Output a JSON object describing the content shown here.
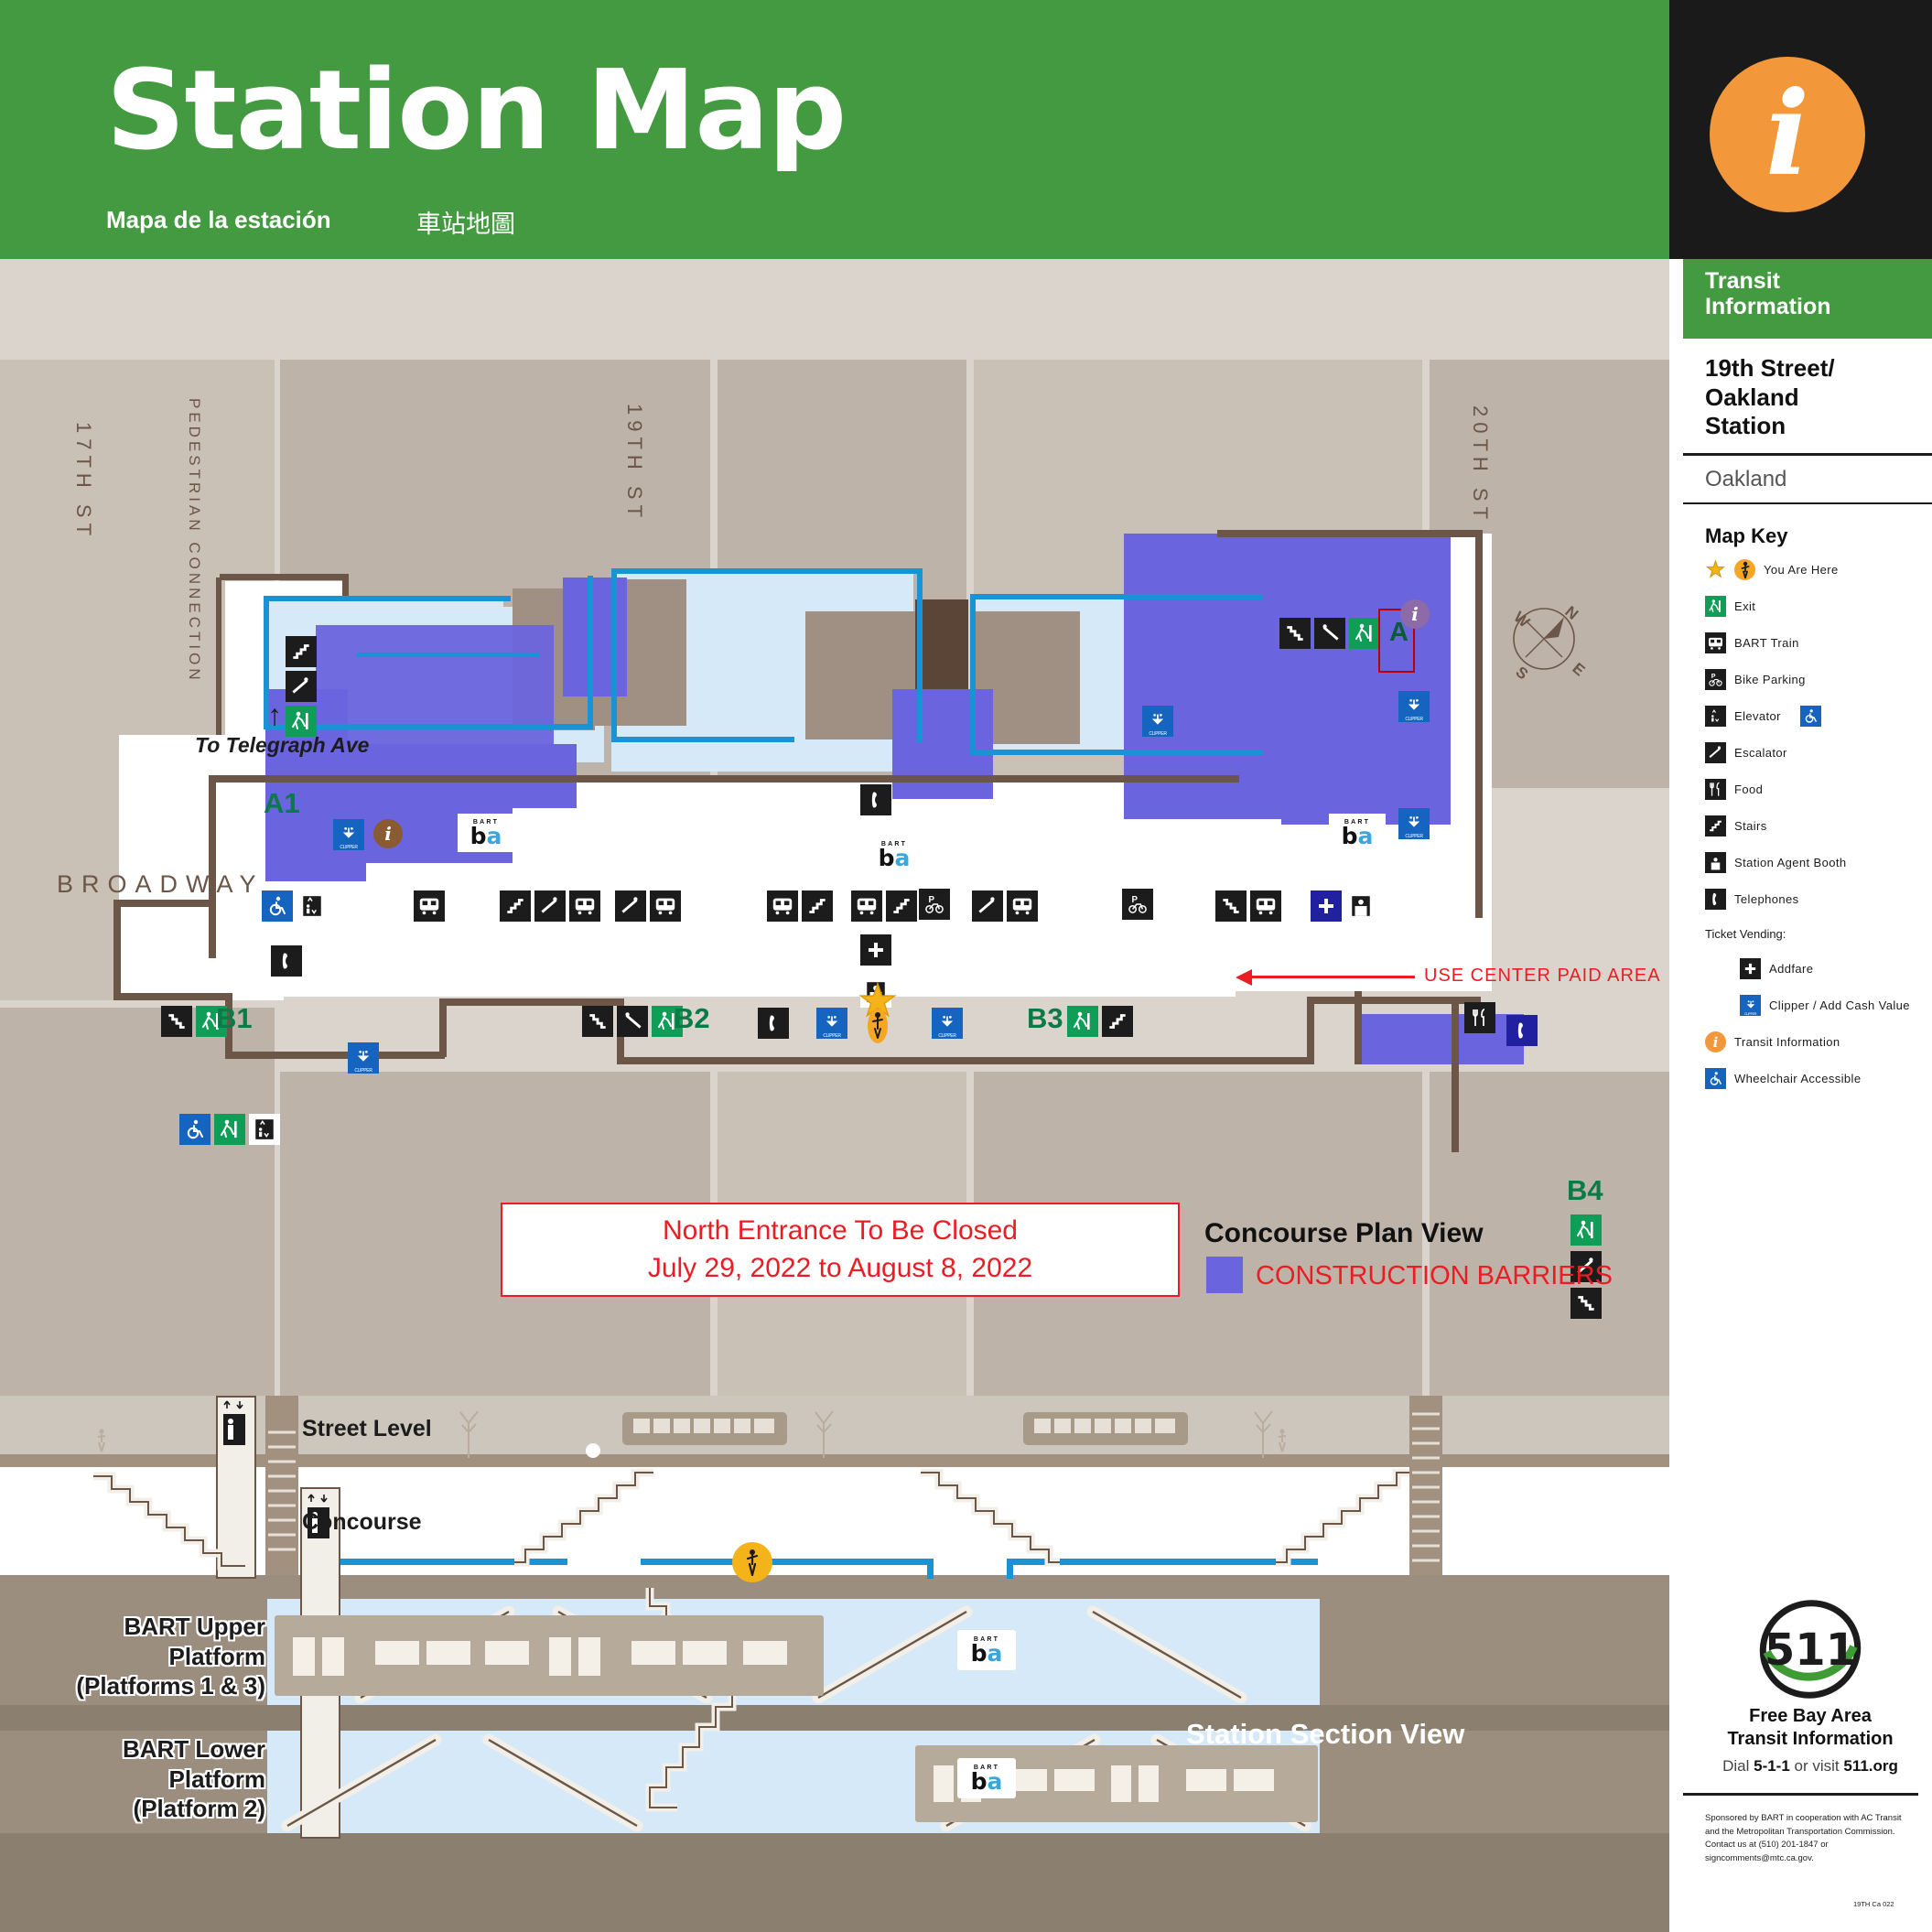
{
  "header": {
    "title": "Station Map",
    "subtitle_es": "Mapa de la estación",
    "subtitle_zh": "車站地圖",
    "info_glyph": "i",
    "green": "#449a40",
    "orange": "#f3973b"
  },
  "panel": {
    "band_title": "Transit\nInformation",
    "station_name": "19th Street/\nOakland\nStation",
    "city": "Oakland",
    "map_key_title": "Map Key",
    "key_items": [
      {
        "icon": "you-are-here-icon",
        "label": "You Are Here"
      },
      {
        "icon": "exit-icon",
        "label": "Exit"
      },
      {
        "icon": "bart-train-icon",
        "label": "BART Train"
      },
      {
        "icon": "bike-parking-icon",
        "label": "Bike Parking"
      },
      {
        "icon": "elevator-icon",
        "label": "Elevator",
        "extra_icon": "wheelchair-icon"
      },
      {
        "icon": "escalator-icon",
        "label": "Escalator"
      },
      {
        "icon": "food-icon",
        "label": "Food"
      },
      {
        "icon": "stairs-icon",
        "label": "Stairs"
      },
      {
        "icon": "station-agent-booth-icon",
        "label": "Station Agent Booth"
      },
      {
        "icon": "telephone-icon",
        "label": "Telephones"
      }
    ],
    "ticket_vending_label": "Ticket Vending:",
    "ticket_items": [
      {
        "icon": "addfare-icon",
        "label": "Addfare"
      },
      {
        "icon": "clipper-icon",
        "label": "Clipper / Add Cash Value"
      }
    ],
    "key_items_tail": [
      {
        "icon": "transit-information-icon",
        "label": "Transit Information"
      },
      {
        "icon": "wheelchair-icon",
        "label": "Wheelchair Accessible"
      }
    ],
    "f511": {
      "number": "511",
      "line1": "Free Bay Area",
      "line2": "Transit Information",
      "dial_prefix": "Dial ",
      "dial_number": "5-1-1",
      "dial_mid": " or visit ",
      "website": "511.org"
    },
    "fineprint": "Sponsored by BART in cooperation with AC Transit and the Metropolitan Transportation Commission. Contact us at (510) 201-1847 or signcomments@mtc.ca.gov.",
    "doc_code": "19TH Ca 022"
  },
  "map": {
    "streets": [
      {
        "name": "17TH ST"
      },
      {
        "name": "PEDESTRIAN CONNECTION"
      },
      {
        "name": "19TH ST"
      },
      {
        "name": "20TH ST"
      },
      {
        "name": "BROADWAY"
      }
    ],
    "to_telegraph": "To Telegraph Ave",
    "to_telegraph_arrow": "↑",
    "entrances": [
      "A1",
      "A",
      "B1",
      "B2",
      "B3",
      "B4"
    ],
    "use_center_note": "USE CENTER PAID AREA",
    "closure_line1": "North Entrance To Be Closed",
    "closure_line2": "July 29, 2022 to August 8, 2022",
    "plan_legend_title": "Concourse Plan View",
    "plan_legend_swatch_label": "CONSTRUCTION BARRIERS",
    "plan_legend_swatch_color": "#6a65de",
    "compass": {
      "n": "N",
      "e": "E",
      "s": "S",
      "w": "W"
    }
  },
  "section": {
    "title": "Station Section View",
    "levels": [
      {
        "label": "Street Level"
      },
      {
        "label": "Concourse"
      },
      {
        "label": "BART Upper Platform\n(Platforms 1 & 3)"
      },
      {
        "label": "BART Lower Platform\n(Platform 2)"
      }
    ],
    "bart_wordmark_top": "BART",
    "bart_wordmark_main": "ba"
  },
  "colors": {
    "green": "#449a40",
    "red": "#ec1c24",
    "barrier_purple": "#6a65de",
    "paid_blue": "#1a93d4",
    "paid_fill": "#d6e9f8",
    "wall_brown": "#6b5647",
    "bg_tan": "#dbd4cd"
  }
}
